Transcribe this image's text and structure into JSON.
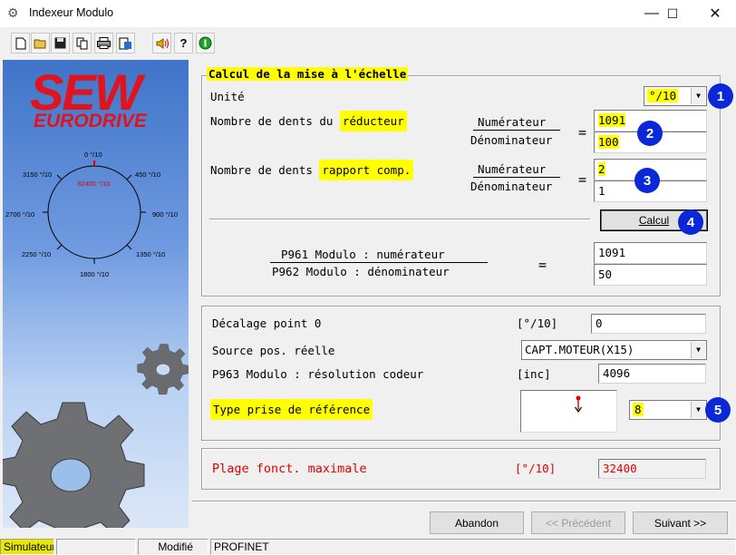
{
  "window": {
    "title": "Indexeur Modulo",
    "app_icon": "gear-app-icon",
    "minimize": "—",
    "maximize": "☐",
    "close": "✕"
  },
  "toolbar": {
    "buttons": [
      "new-icon",
      "open-icon",
      "save-icon",
      "copy-icon",
      "print-icon",
      "export-icon",
      "speaker-icon",
      "help-icon",
      "info-icon"
    ]
  },
  "brand": {
    "line1": "SEW",
    "line2": "EURODRIVE"
  },
  "dial": {
    "top": "0 °/10",
    "center": "32400 °/10",
    "r450": "450 °/10",
    "r900": "900 °/10",
    "r1350": "1350 °/10",
    "b1800": "1800 °/10",
    "l2250": "2250 °/10",
    "l2700": "2700 °/10",
    "l3150": "3150 °/10"
  },
  "calc_group": {
    "title": "Calcul de la mise à l'échelle",
    "unit_label": "Unité",
    "unit_value": "°/10",
    "gear_label_a": "Nombre de dents du",
    "gear_label_b": "réducteur",
    "ratio_label_a": "Nombre de dents",
    "ratio_label_b": "rapport comp.",
    "numerator": "Numérateur",
    "denominator": "Dénominateur",
    "equals": "=",
    "gear_num": "1091",
    "gear_den": "100",
    "ratio_num": "2",
    "ratio_den": "1",
    "calc_button": "Calcul",
    "p961": "P961 Modulo : numérateur",
    "p962": "P962 Modulo : dénominateur",
    "result_num": "1091",
    "result_den": "50"
  },
  "param_group": {
    "offset_label": "Décalage point 0",
    "offset_unit": "[°/10]",
    "offset_value": "0",
    "source_label": "Source pos. réelle",
    "source_value": "CAPT.MOTEUR(X15)",
    "res_label": "P963 Modulo : résolution codeur",
    "res_unit": "[inc]",
    "res_value": "4096",
    "ref_label": "Type prise de référence",
    "ref_value": "8"
  },
  "range_group": {
    "label": "Plage fonct. maximale",
    "unit": "[°/10]",
    "value": "32400",
    "accent": "#e00000"
  },
  "badges": [
    "1",
    "2",
    "3",
    "4",
    "5"
  ],
  "nav": {
    "cancel": "Abandon",
    "previous": "<< Précédent",
    "next": "Suivant >>"
  },
  "status": {
    "mode": "Simulateur",
    "state": "Modifié",
    "bus": "PROFINET",
    "mode_color": "#e8e800"
  }
}
